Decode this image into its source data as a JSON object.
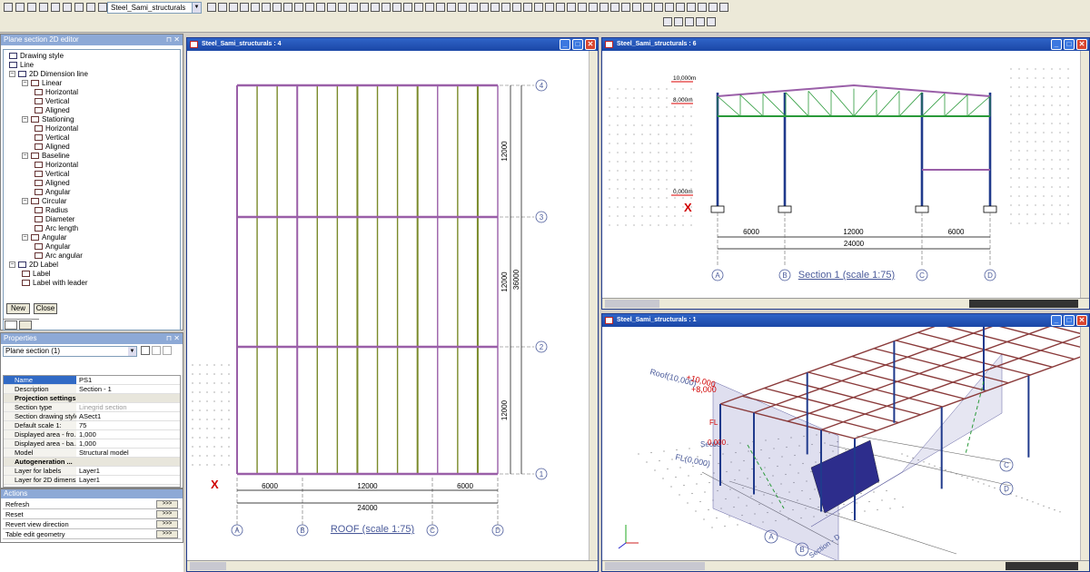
{
  "toolbar": {
    "project_combo": "Steel_Sami_structurals"
  },
  "left": {
    "editor_title": "Plane section 2D editor",
    "tree": [
      {
        "label": "Drawing style",
        "lvl": 0
      },
      {
        "label": "Line",
        "lvl": 0
      },
      {
        "label": "2D Dimension line",
        "lvl": 0
      },
      {
        "label": "Linear",
        "lvl": 1
      },
      {
        "label": "Horizontal",
        "lvl": 2
      },
      {
        "label": "Vertical",
        "lvl": 2
      },
      {
        "label": "Aligned",
        "lvl": 2
      },
      {
        "label": "Stationing",
        "lvl": 1
      },
      {
        "label": "Horizontal",
        "lvl": 2
      },
      {
        "label": "Vertical",
        "lvl": 2
      },
      {
        "label": "Aligned",
        "lvl": 2
      },
      {
        "label": "Baseline",
        "lvl": 1
      },
      {
        "label": "Horizontal",
        "lvl": 2
      },
      {
        "label": "Vertical",
        "lvl": 2
      },
      {
        "label": "Aligned",
        "lvl": 2
      },
      {
        "label": "Angular",
        "lvl": 2
      },
      {
        "label": "Circular",
        "lvl": 1
      },
      {
        "label": "Radius",
        "lvl": 2
      },
      {
        "label": "Diameter",
        "lvl": 2
      },
      {
        "label": "Arc length",
        "lvl": 2
      },
      {
        "label": "Angular",
        "lvl": 1
      },
      {
        "label": "Angular",
        "lvl": 2
      },
      {
        "label": "Arc angular",
        "lvl": 2
      },
      {
        "label": "2D Label",
        "lvl": 0
      },
      {
        "label": "Label",
        "lvl": 1
      },
      {
        "label": "Label with leader",
        "lvl": 1
      }
    ],
    "new_label": "New",
    "close_label": "Close",
    "properties_title": "Properties",
    "properties_combo": "Plane section (1)",
    "props": [
      {
        "k": "Name",
        "v": "PS1",
        "cat": false
      },
      {
        "k": "Description",
        "v": "Section - 1",
        "cat": false
      },
      {
        "k": "Projection settings",
        "v": "",
        "cat": true
      },
      {
        "k": "Section type",
        "v": "Linegrid section",
        "cat": false
      },
      {
        "k": "Section drawing style",
        "v": "ASect1",
        "cat": false
      },
      {
        "k": "Default scale 1:",
        "v": "75",
        "cat": false
      },
      {
        "k": "Displayed area - fro...",
        "v": "1,000",
        "cat": false
      },
      {
        "k": "Displayed area - ba...",
        "v": "1,000",
        "cat": false
      },
      {
        "k": "Model",
        "v": "Structural model",
        "cat": false
      },
      {
        "k": "Autogeneration ...",
        "v": "",
        "cat": true
      },
      {
        "k": "Layer for labels",
        "v": "Layer1",
        "cat": false
      },
      {
        "k": "Layer for 2D dimensi...",
        "v": "Layer1",
        "cat": false
      }
    ],
    "actions_title": "Actions",
    "actions": [
      "Refresh",
      "Reset",
      "Revert view direction",
      "Table edit geometry"
    ],
    "action_go": ">>>"
  },
  "windows": {
    "plan": {
      "title": "Steel_Sami_structurals : 4",
      "caption": "ROOF (scale 1:75)",
      "axes_x": [
        "A",
        "B",
        "C",
        "D"
      ],
      "axes_y": [
        "1",
        "2",
        "3",
        "4"
      ],
      "dims_bottom": [
        "6000",
        "12000",
        "6000"
      ],
      "dim_total": "24000",
      "dims_right": [
        "12000",
        "12000",
        "12000"
      ],
      "dim_right_total": "36000"
    },
    "section": {
      "title": "Steel_Sami_structurals : 6",
      "caption": "Section 1 (scale 1:75)",
      "axes": [
        "A",
        "B",
        "C",
        "D"
      ],
      "dims": [
        "6000",
        "12000",
        "6000"
      ],
      "dim_total": "24000",
      "levels": [
        "10,000m",
        "8,000m",
        "0,000m"
      ]
    },
    "view3d": {
      "title": "Steel_Sami_structurals : 1",
      "labels": [
        "Roof(10,000)",
        "+10,000",
        "+8,000",
        "FL",
        "Sectio",
        "FL(0,000)",
        "0,000"
      ],
      "grid_labels": [
        "A",
        "B",
        "C",
        "D"
      ],
      "section_label": "Section - D"
    }
  },
  "colors": {
    "title_bar": "#1b47a6",
    "beam": "#9a5fa8",
    "column": "#7a8a2a",
    "dim": "#000000",
    "axis": "#4a5a9a",
    "red": "#d00000"
  }
}
